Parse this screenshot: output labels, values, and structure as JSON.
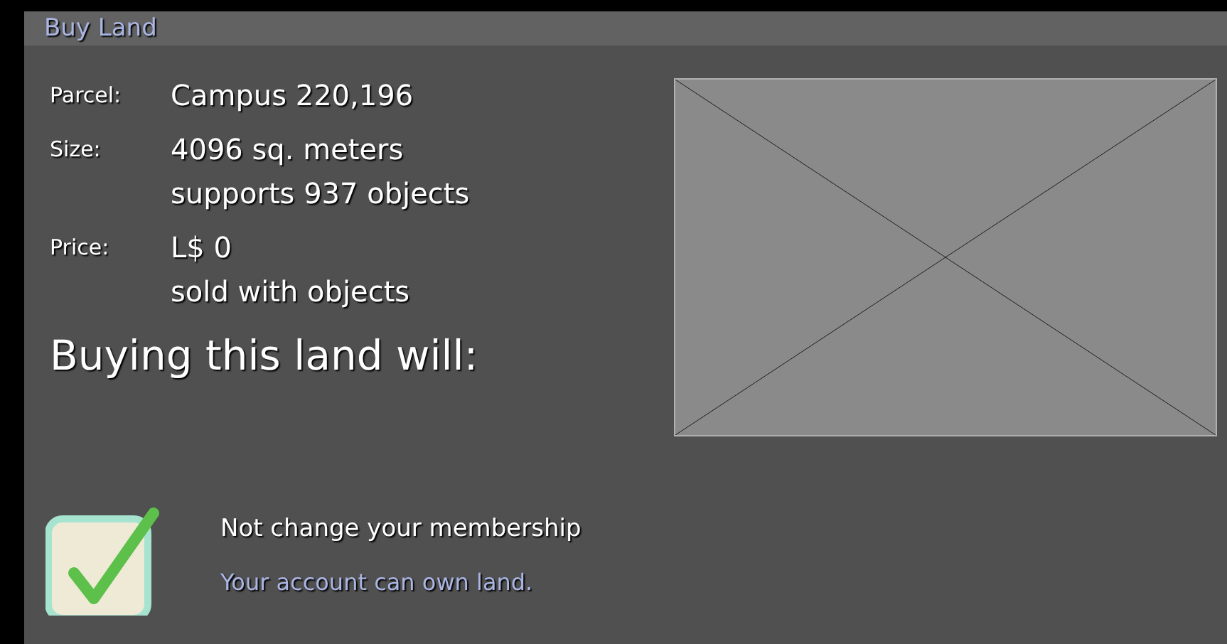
{
  "window": {
    "title": "Buy Land"
  },
  "details": [
    {
      "label": "Parcel:",
      "lines": [
        "Campus 220,196"
      ]
    },
    {
      "label": "Size:",
      "lines": [
        "4096 sq. meters",
        "supports 937 objects"
      ]
    },
    {
      "label": "Price:",
      "lines": [
        "L$ 0",
        "sold with objects"
      ]
    }
  ],
  "heading": "Buying this land will:",
  "effects": [
    {
      "checked": true,
      "title": "Not change your membership",
      "note": "Your account can own land."
    }
  ]
}
